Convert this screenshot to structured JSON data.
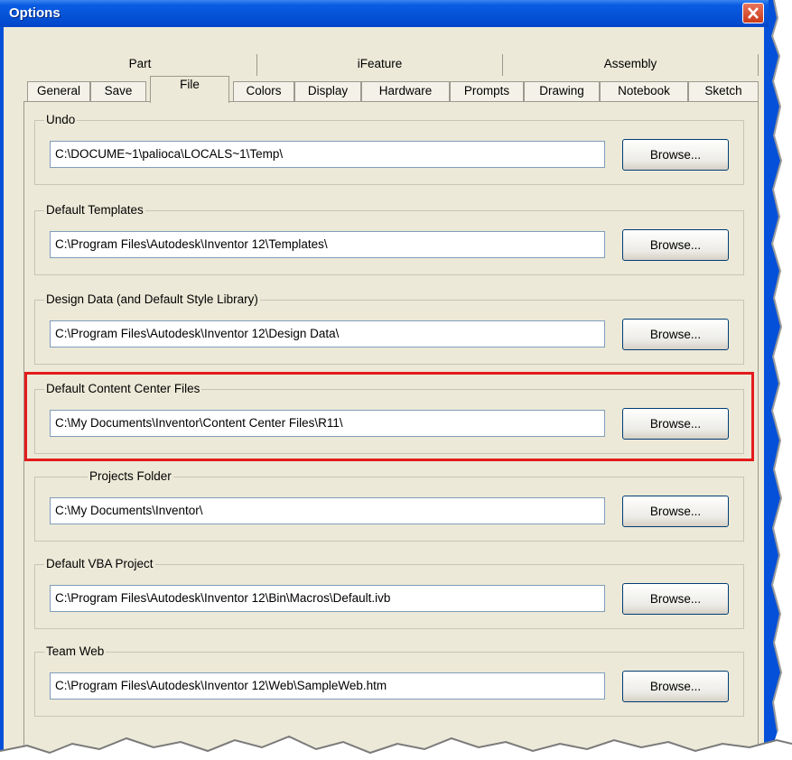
{
  "window": {
    "title": "Options"
  },
  "tabs": {
    "row1": [
      "Part",
      "iFeature",
      "Assembly"
    ],
    "row2": [
      "General",
      "Save",
      "File",
      "Colors",
      "Display",
      "Hardware",
      "Prompts",
      "Drawing",
      "Notebook",
      "Sketch"
    ],
    "active": "File"
  },
  "groups": [
    {
      "label": "Undo",
      "path": "C:\\DOCUME~1\\palioca\\LOCALS~1\\Temp\\",
      "button": "Browse..."
    },
    {
      "label": "Default Templates",
      "path": "C:\\Program Files\\Autodesk\\Inventor 12\\Templates\\",
      "button": "Browse..."
    },
    {
      "label": "Design Data (and Default Style Library)",
      "path": "C:\\Program Files\\Autodesk\\Inventor 12\\Design Data\\",
      "button": "Browse..."
    },
    {
      "label": "Default Content Center Files",
      "path": "C:\\My Documents\\Inventor\\Content Center Files\\R11\\",
      "button": "Browse...",
      "highlighted": true
    },
    {
      "label": "Projects Folder",
      "path": "C:\\My Documents\\Inventor\\",
      "button": "Browse..."
    },
    {
      "label": "Default VBA Project",
      "path": "C:\\Program Files\\Autodesk\\Inventor 12\\Bin\\Macros\\Default.ivb",
      "button": "Browse..."
    },
    {
      "label": "Team Web",
      "path": "C:\\Program Files\\Autodesk\\Inventor 12\\Web\\SampleWeb.htm",
      "button": "Browse..."
    }
  ],
  "colors": {
    "titlebar": "#0552d6",
    "highlight": "#e31b1b",
    "dialog": "#ece9d8"
  },
  "icons": {
    "close": "close-icon"
  }
}
